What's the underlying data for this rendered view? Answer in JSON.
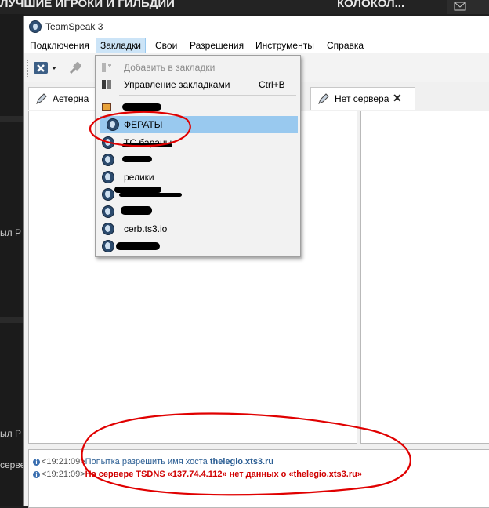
{
  "background": {
    "top_left_text": "ЛУЧШИЕ ИГРОКИ И ГИЛЬДИИ",
    "top_right_text": "КОЛОКОЛ...",
    "side_text_1": "ыл Р",
    "side_text_2": "ыл Р",
    "side_text_3": "сервер"
  },
  "window": {
    "title": "TeamSpeak 3"
  },
  "menu": {
    "items": [
      "Подключения",
      "Закладки",
      "Свои",
      "Разрешения",
      "Инструменты",
      "Справка"
    ],
    "active_index": 1
  },
  "tabs": [
    {
      "label": "Аетерна"
    },
    {
      "label": "Нет сервера"
    }
  ],
  "bookmarks_menu": {
    "add_label": "Добавить в закладки",
    "manage_label": "Управление закладками",
    "manage_shortcut": "Ctrl+B",
    "entries": [
      "",
      "ФЕРАТЫ",
      "ТС бараны",
      "",
      "релики",
      "",
      "",
      "cerb.ts3.io",
      ""
    ],
    "highlighted_index": 1
  },
  "log": [
    {
      "time": "<19:21:09>",
      "text": "Попытка разрешить имя хоста ",
      "host": "thelegio.xts3.ru"
    },
    {
      "time": "<19:21:09>",
      "error": "На сервере TSDNS «137.74.4.112» нет данных о «thelegio.xts3.ru»"
    }
  ],
  "colors": {
    "highlight": "#99c9ef",
    "error_text": "#d00000",
    "info_text": "#2a5d93",
    "annotation_red": "#e00000"
  }
}
